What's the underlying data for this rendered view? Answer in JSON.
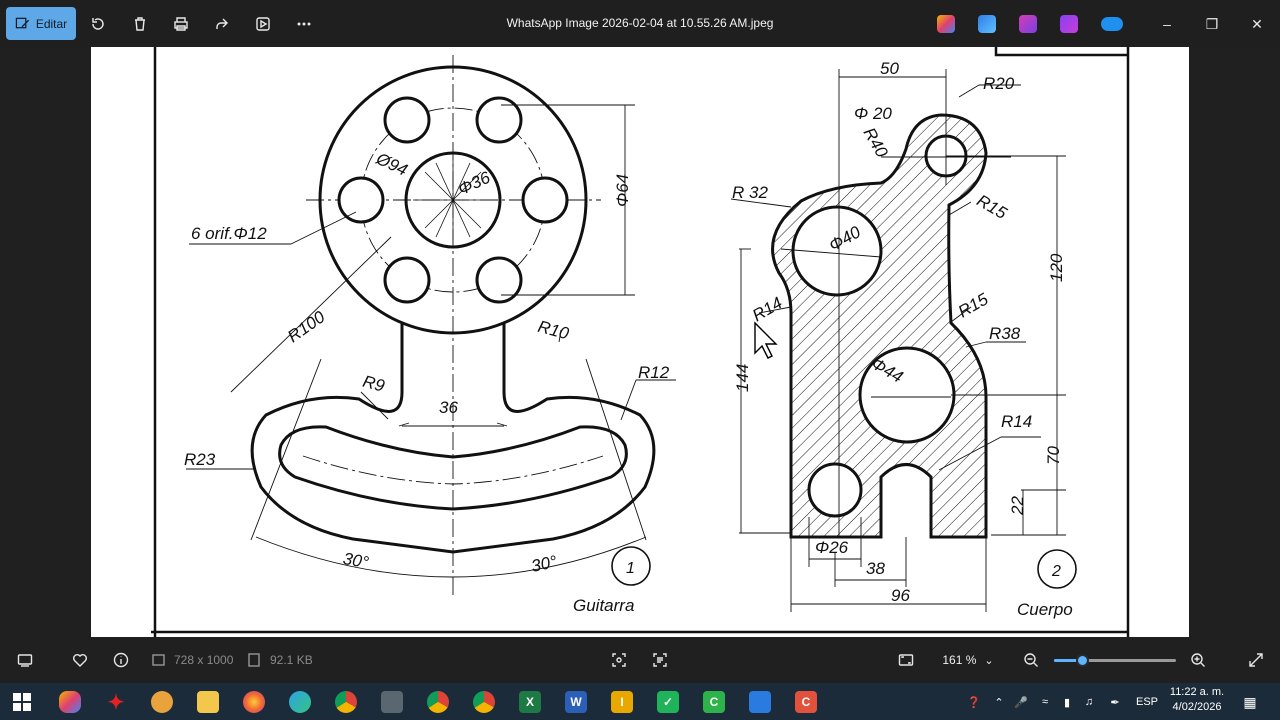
{
  "toolbar": {
    "edit_label": "Editar",
    "window_title": "WhatsApp Image 2026-02-04 at 10.55.26 AM.jpeg"
  },
  "drawing": {
    "part1": {
      "number": "1",
      "name": "Guitarra",
      "dims": {
        "d94": "Ø94",
        "d36": "Φ36",
        "d64": "Φ64",
        "holes": "6 orif.Φ12",
        "r100": "R100",
        "r10": "R10",
        "r9": "R9",
        "w36": "36",
        "r12": "R12",
        "r23": "R23",
        "a30_left": "30°",
        "a30_right": "30°"
      }
    },
    "part2": {
      "number": "2",
      "name": "Cuerpo",
      "dims": {
        "d50": "50",
        "r20": "R20",
        "d20": "Φ 20",
        "r40": "R40",
        "r32": "R 32",
        "d40": "Φ40",
        "r15_top": "R15",
        "d120": "120",
        "r14_left": "R14",
        "r15_mid": "R15",
        "r38": "R38",
        "d144": "144",
        "d44": "Φ44",
        "r14_right": "R14",
        "d70": "70",
        "d22": "22",
        "d26": "Φ26",
        "d38": "38",
        "d96": "96"
      }
    }
  },
  "statusbar": {
    "dimensions": "728 x 1000",
    "file_size": "92.1 KB",
    "zoom": "161 %",
    "zoom_fraction": 0.23
  },
  "taskbar": {
    "language": "ESP",
    "time": "11:22 a. m.",
    "date": "4/02/2026"
  },
  "colors": {
    "accent": "#5fa8e8",
    "slider": "#5fb4ff"
  }
}
